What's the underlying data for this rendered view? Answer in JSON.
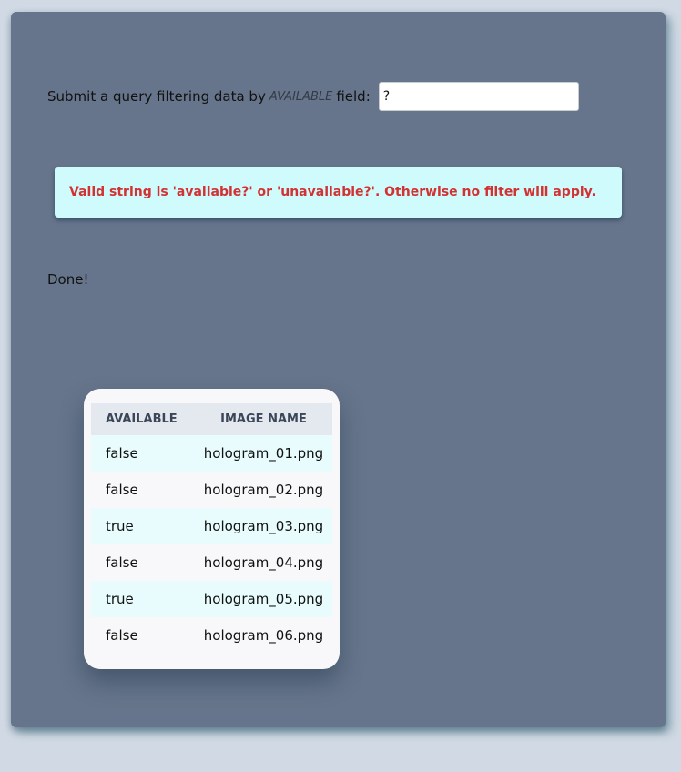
{
  "query": {
    "prompt_prefix": "Submit a query filtering data by",
    "field_name": "AVAILABLE",
    "prompt_suffix": "field:",
    "input_value": "?"
  },
  "notice": {
    "text": "Valid string is 'available?' or 'unavailable?'. Otherwise no filter will apply."
  },
  "status": {
    "text": "Done!"
  },
  "table": {
    "headers": [
      "AVAILABLE",
      "IMAGE NAME"
    ],
    "rows": [
      {
        "available": "false",
        "image_name": "hologram_01.png"
      },
      {
        "available": "false",
        "image_name": "hologram_02.png"
      },
      {
        "available": "true",
        "image_name": "hologram_03.png"
      },
      {
        "available": "false",
        "image_name": "hologram_04.png"
      },
      {
        "available": "true",
        "image_name": "hologram_05.png"
      },
      {
        "available": "false",
        "image_name": "hologram_06.png"
      }
    ]
  }
}
